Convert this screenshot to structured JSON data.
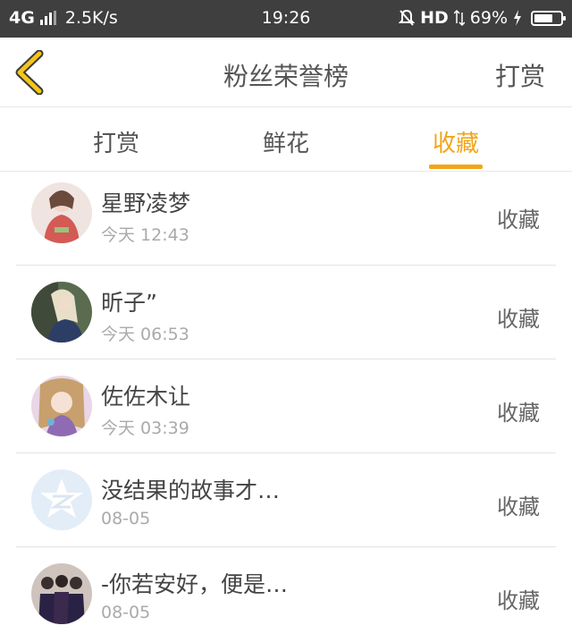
{
  "status_bar": {
    "network": "4G",
    "speed": "2.5K/s",
    "time": "19:26",
    "hd": "HD",
    "battery": "69%"
  },
  "header": {
    "title": "粉丝荣誉榜",
    "action": "打赏"
  },
  "tabs": [
    {
      "label": "打赏",
      "active": false
    },
    {
      "label": "鲜花",
      "active": false
    },
    {
      "label": "收藏",
      "active": true
    }
  ],
  "list": [
    {
      "name": "星野凌梦",
      "time": "今天 12:43",
      "action": "收藏",
      "avatar_icon": "avatar-girl-red-kimono"
    },
    {
      "name": "昕子”",
      "time": "今天 06:53",
      "action": "收藏",
      "avatar_icon": "avatar-girl-blonde"
    },
    {
      "name": "佐佐木让",
      "time": "今天 03:39",
      "action": "收藏",
      "avatar_icon": "avatar-anime-girl"
    },
    {
      "name": "没结果的故事才…",
      "time": "08-05",
      "action": "收藏",
      "avatar_icon": "qzone-default-avatar"
    },
    {
      "name": "-你若安好，便是…",
      "time": "08-05",
      "action": "收藏",
      "avatar_icon": "avatar-group-photo"
    }
  ],
  "colors": {
    "accent": "#f2a51a",
    "status_bar_bg": "#3f3f3f",
    "back_icon": "#f5c518"
  }
}
